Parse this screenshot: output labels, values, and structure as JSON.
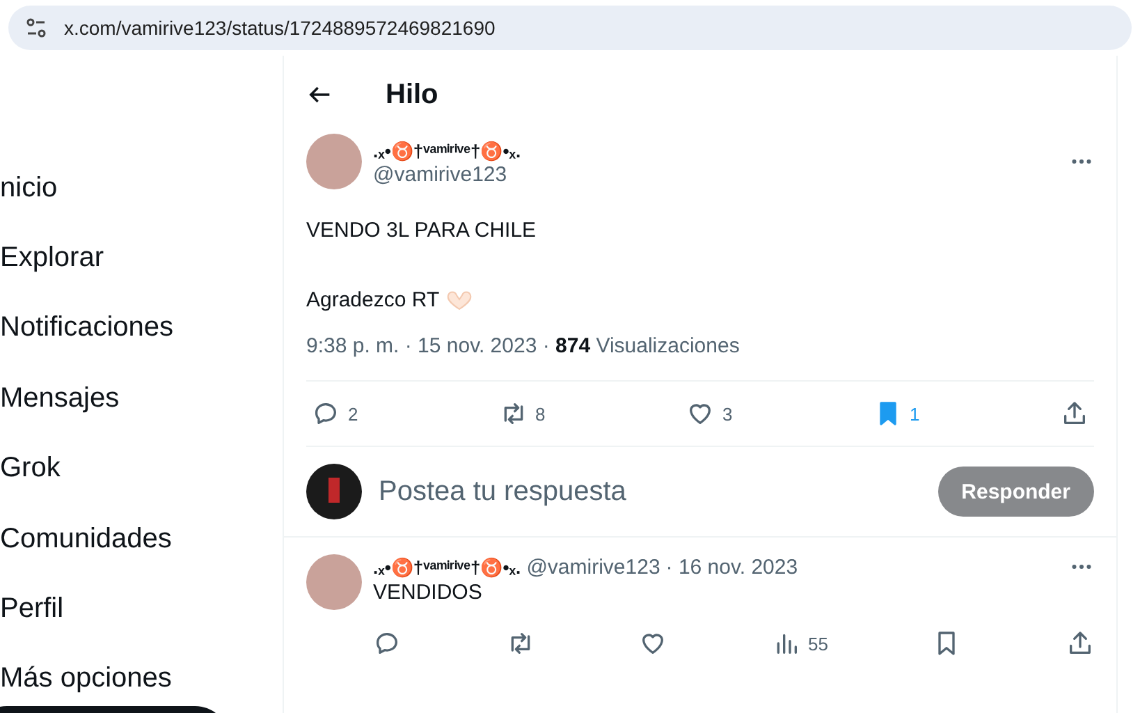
{
  "browser": {
    "url": "x.com/vamirive123/status/1724889572469821690"
  },
  "sidebar": {
    "items": [
      {
        "label": "nicio"
      },
      {
        "label": "Explorar"
      },
      {
        "label": "Notificaciones"
      },
      {
        "label": "Mensajes"
      },
      {
        "label": "Grok"
      },
      {
        "label": "Comunidades"
      },
      {
        "label": "Perfil"
      },
      {
        "label": "Más opciones"
      }
    ]
  },
  "header": {
    "title": "Hilo"
  },
  "post": {
    "display_name": ".ₓ•♉†ᵛᵃᵐⁱʳⁱᵛᵉ†♉•ₓ.",
    "handle": "@vamirive123",
    "lines": [
      "VENDO 3L PARA CHILE",
      "Agradezco RT"
    ],
    "time": "9:38 p. m. · 15 nov. 2023",
    "separator": "·",
    "views_count": "874",
    "views_label": "Visualizaciones",
    "actions": [
      {
        "kind": "reply",
        "count": "2",
        "selected": false
      },
      {
        "kind": "repost",
        "count": "8",
        "selected": false
      },
      {
        "kind": "like",
        "count": "3",
        "selected": false
      },
      {
        "kind": "bookmark",
        "count": "1",
        "selected": true
      },
      {
        "kind": "share",
        "selected": false
      }
    ]
  },
  "composer": {
    "placeholder": "Postea tu respuesta",
    "button": "Responder"
  },
  "reply": {
    "display_name": ".ₓ•♉†ᵛᵃᵐⁱʳⁱᵛᵉ†♉•ₓ.",
    "handle": "@vamirive123",
    "separator": "·",
    "date": "16 nov. 2023",
    "text": "VENDIDOS",
    "actions": [
      {
        "kind": "reply",
        "selected": false
      },
      {
        "kind": "repost",
        "selected": false
      },
      {
        "kind": "like",
        "selected": false
      },
      {
        "kind": "views",
        "count": "55",
        "selected": false
      },
      {
        "kind": "bookmark",
        "selected": false
      },
      {
        "kind": "share",
        "selected": false
      }
    ]
  }
}
